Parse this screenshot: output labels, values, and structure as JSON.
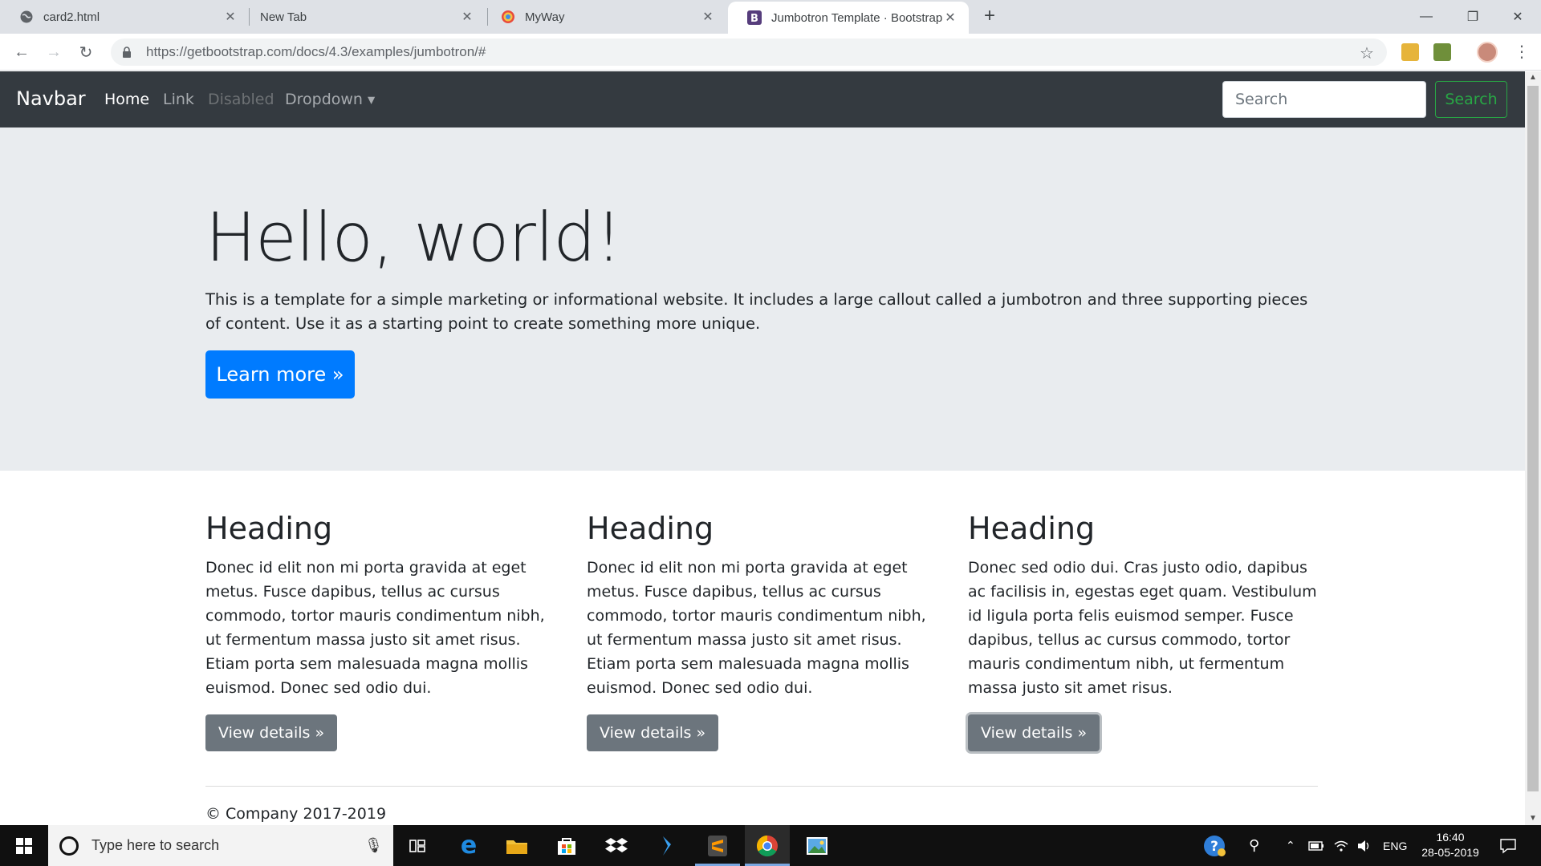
{
  "browser": {
    "tabs": [
      {
        "title": "card2.html",
        "icon": "globe-icon",
        "active": false
      },
      {
        "title": "New Tab",
        "icon": "",
        "active": false
      },
      {
        "title": "MyWay",
        "icon": "myway-icon",
        "active": false
      },
      {
        "title": "Jumbotron Template · Bootstrap",
        "icon": "bootstrap-icon",
        "active": true
      }
    ],
    "url": "https://getbootstrap.com/docs/4.3/examples/jumbotron/#"
  },
  "navbar": {
    "brand": "Navbar",
    "links": [
      {
        "label": "Home",
        "state": "active"
      },
      {
        "label": "Link",
        "state": "normal"
      },
      {
        "label": "Disabled",
        "state": "disabled"
      },
      {
        "label": "Dropdown",
        "state": "dropdown"
      }
    ],
    "search_placeholder": "Search",
    "search_button": "Search",
    "colors": {
      "background": "#343a40",
      "active": "#ffffff",
      "link": "#a7abaf",
      "disabled": "#6d7174",
      "success": "#28a745"
    }
  },
  "jumbotron": {
    "title": "Hello, world!",
    "text": "This is a template for a simple marketing or informational website. It includes a large callout called a jumbotron and three supporting pieces of content. Use it as a starting point to create something more unique.",
    "button": "Learn more »",
    "colors": {
      "background": "#e9ecef",
      "primary": "#007bff"
    }
  },
  "columns": [
    {
      "heading": "Heading",
      "text": "Donec id elit non mi porta gravida at eget metus. Fusce dapibus, tellus ac cursus commodo, tortor mauris condimentum nibh, ut fermentum massa justo sit amet risus. Etiam porta sem malesuada magna mollis euismod. Donec sed odio dui.",
      "button": "View details »"
    },
    {
      "heading": "Heading",
      "text": "Donec id elit non mi porta gravida at eget metus. Fusce dapibus, tellus ac cursus commodo, tortor mauris condimentum nibh, ut fermentum massa justo sit amet risus. Etiam porta sem malesuada magna mollis euismod. Donec sed odio dui.",
      "button": "View details »"
    },
    {
      "heading": "Heading",
      "text": "Donec sed odio dui. Cras justo odio, dapibus ac facilisis in, egestas eget quam. Vestibulum id ligula porta felis euismod semper. Fusce dapibus, tellus ac cursus commodo, tortor mauris condimentum nibh, ut fermentum massa justo sit amet risus.",
      "button": "View details »"
    }
  ],
  "footer": "© Company 2017-2019",
  "taskbar": {
    "search_placeholder": "Type here to search",
    "language": "ENG",
    "time": "16:40",
    "date": "28-05-2019",
    "pinned": [
      "task-view-icon",
      "edge-icon",
      "file-explorer-icon",
      "store-icon",
      "dropbox-icon",
      "visual-studio-icon",
      "sublime-text-icon",
      "chrome-icon",
      "photos-icon"
    ]
  }
}
